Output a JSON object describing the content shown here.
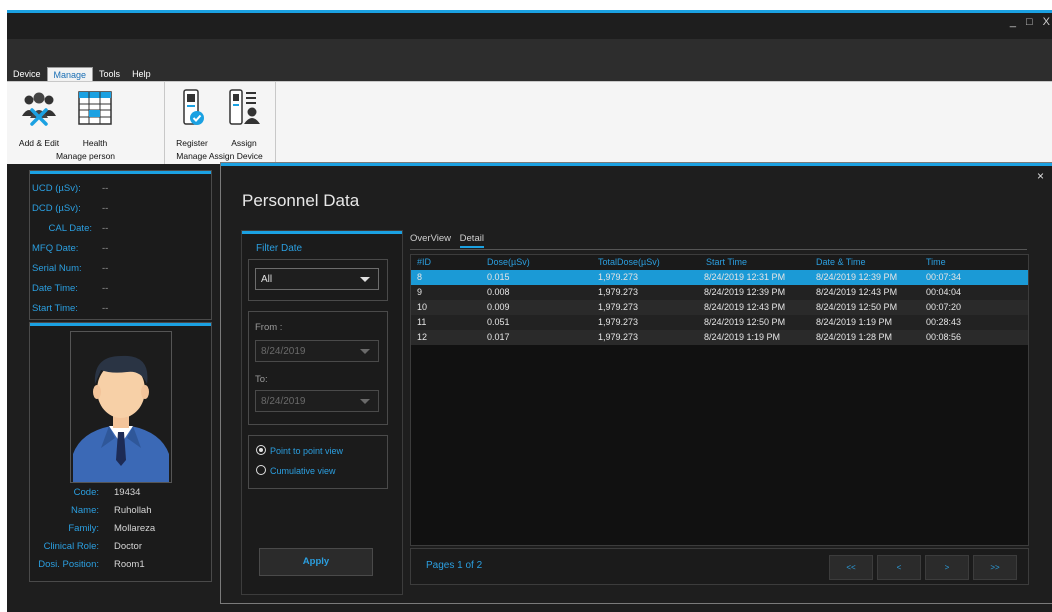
{
  "window": {
    "controls": {
      "minimize": "_",
      "maximize": "□",
      "close": "X"
    }
  },
  "menu": {
    "items": [
      {
        "label": "Device",
        "active": false
      },
      {
        "label": "Manage",
        "active": true
      },
      {
        "label": "Tools",
        "active": false
      },
      {
        "label": "Help",
        "active": false
      }
    ]
  },
  "ribbon": {
    "groups": [
      {
        "title": "Manage person",
        "buttons": [
          {
            "label": "Add & Edit",
            "icon": "people-tools-icon"
          },
          {
            "label": "Health",
            "icon": "health-table-icon"
          }
        ]
      },
      {
        "title": "Manage Assign Device",
        "buttons": [
          {
            "label": "Register",
            "icon": "dosimeter-check-icon"
          },
          {
            "label": "Assign",
            "icon": "dosimeter-person-icon"
          }
        ]
      }
    ]
  },
  "device_info": {
    "fields": [
      {
        "label": "UCD (µSv):",
        "value": "--"
      },
      {
        "label": "DCD (µSv):",
        "value": "--"
      },
      {
        "label": "CAL Date:",
        "value": "--"
      },
      {
        "label": "MFQ Date:",
        "value": "--"
      },
      {
        "label": "Serial Num:",
        "value": "--"
      },
      {
        "label": "Date Time:",
        "value": "--"
      },
      {
        "label": "Start Time:",
        "value": "--"
      }
    ]
  },
  "person": {
    "fields": [
      {
        "label": "Code:",
        "value": "19434"
      },
      {
        "label": "Name:",
        "value": "Ruhollah"
      },
      {
        "label": "Family:",
        "value": "Mollareza"
      },
      {
        "label": "Clinical Role:",
        "value": "Doctor"
      },
      {
        "label": "Dosi. Position:",
        "value": "Room1"
      }
    ]
  },
  "personnel": {
    "title": "Personnel Data",
    "close": "×",
    "filter": {
      "title": "Filter Date",
      "range": "All",
      "from_label": "From :",
      "from_value": "8/24/2019",
      "to_label": "To:",
      "to_value": "8/24/2019",
      "views": [
        {
          "label": "Point to point view",
          "selected": true
        },
        {
          "label": "Cumulative view",
          "selected": false
        }
      ],
      "apply": "Apply"
    },
    "tabs": [
      {
        "label": "OverView",
        "active": false
      },
      {
        "label": "Detail",
        "active": true
      }
    ],
    "table": {
      "columns": [
        "#ID",
        "Dose(µSv)",
        "TotalDose(µSv)",
        "Start Time",
        "Date & Time",
        "Time"
      ],
      "rows": [
        [
          "8",
          "0.015",
          "1,979.273",
          "8/24/2019 12:31 PM",
          "8/24/2019 12:39 PM",
          "00:07:34"
        ],
        [
          "9",
          "0.008",
          "1,979.273",
          "8/24/2019 12:39 PM",
          "8/24/2019 12:43 PM",
          "00:04:04"
        ],
        [
          "10",
          "0.009",
          "1,979.273",
          "8/24/2019 12:43 PM",
          "8/24/2019 12:50 PM",
          "00:07:20"
        ],
        [
          "11",
          "0.051",
          "1,979.273",
          "8/24/2019 12:50 PM",
          "8/24/2019 1:19 PM",
          "00:28:43"
        ],
        [
          "12",
          "0.017",
          "1,979.273",
          "8/24/2019 1:19 PM",
          "8/24/2019 1:28 PM",
          "00:08:56"
        ]
      ],
      "selected_row": 0
    },
    "pager": {
      "text": "Pages 1 of 2",
      "buttons": [
        "<<",
        "<",
        ">",
        ">>"
      ]
    }
  },
  "colors": {
    "accent": "#1ba1e2",
    "label_blue": "#2b9fe0",
    "selected_row": "#1b9ad6",
    "background": "#1e1e1e"
  }
}
